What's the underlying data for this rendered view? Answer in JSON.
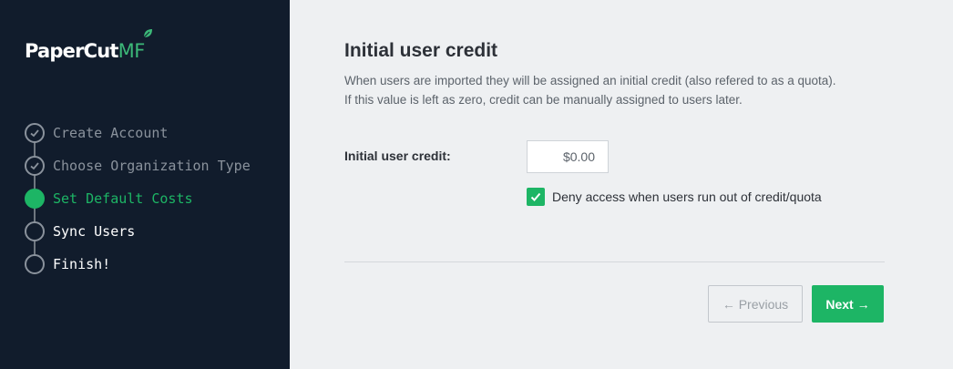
{
  "brand": {
    "name_main": "PaperCut",
    "name_suffix": "MF",
    "colors": {
      "accent": "#1db565",
      "sidebar_bg": "#111c2c",
      "leaf": "#3cb878"
    }
  },
  "sidebar": {
    "steps": [
      {
        "label": "Create Account",
        "state": "done",
        "icon": "check-circle-icon"
      },
      {
        "label": "Choose Organization Type",
        "state": "done",
        "icon": "check-circle-icon"
      },
      {
        "label": "Set Default Costs",
        "state": "active",
        "icon": "filled-circle-icon"
      },
      {
        "label": "Sync Users",
        "state": "todo",
        "icon": "empty-circle-icon"
      },
      {
        "label": "Finish!",
        "state": "todo",
        "icon": "empty-circle-icon"
      }
    ]
  },
  "main": {
    "title": "Initial user credit",
    "description_line1": "When users are imported they will be assigned an initial credit (also refered to as a quota).",
    "description_line2": "If this value is left as zero, credit can be manually assigned to users later.",
    "credit_label": "Initial user credit:",
    "credit_value": "$0.00",
    "deny_access_label": "Deny access when users run out of credit/quota",
    "deny_access_checked": true
  },
  "footer": {
    "previous_label": "← Previous",
    "next_label": "Next →"
  }
}
